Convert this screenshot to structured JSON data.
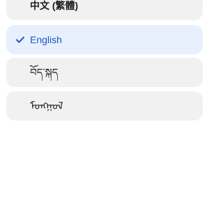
{
  "language_list": {
    "items": [
      {
        "label": "中文 (繁體)",
        "selected": false
      },
      {
        "label": "English",
        "selected": true
      },
      {
        "label": "བོད་སྐད",
        "selected": false
      },
      {
        "label": "ᠮᠣᠩᠭᠣᠯ",
        "selected": false
      }
    ]
  },
  "icons": {
    "selected_marker": "check-icon"
  },
  "colors": {
    "item_background": "#f1f1f1",
    "selected_background": "#e8f0fd",
    "selected_accent": "#1a56c5",
    "text": "#1f1f1f"
  }
}
